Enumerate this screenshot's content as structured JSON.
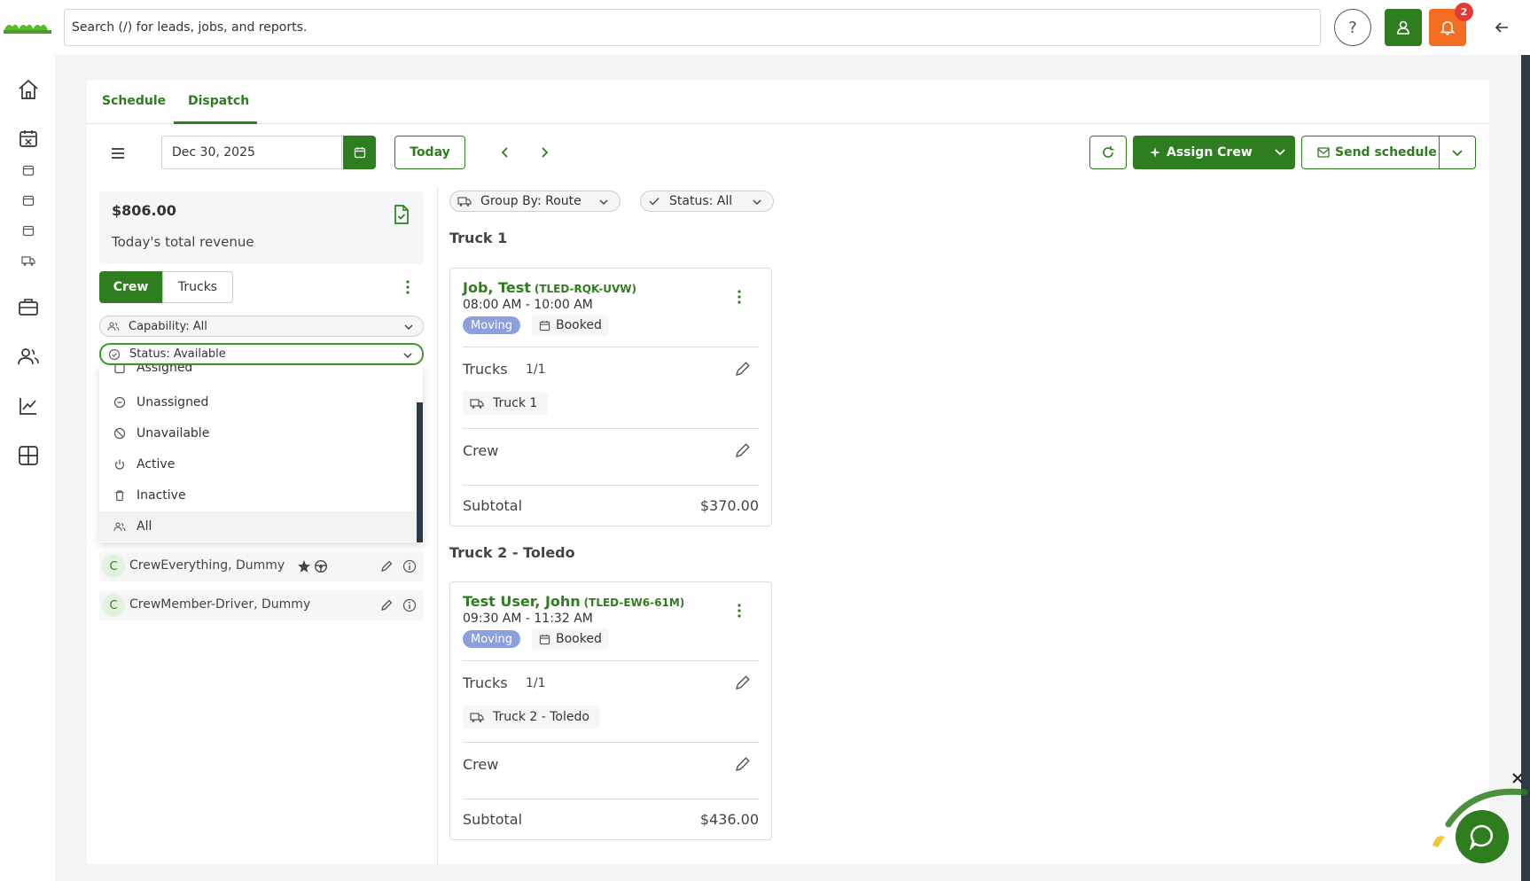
{
  "header": {
    "search_placeholder": "Search (/) for leads, jobs, and reports.",
    "help_label": "?",
    "notification_count": "2"
  },
  "tabs": [
    {
      "label": "Schedule"
    },
    {
      "label": "Dispatch"
    }
  ],
  "toolbar": {
    "date_value": "Dec 30, 2025",
    "today_label": "Today",
    "assign_label": "Assign Crew",
    "send_label": "Send schedule"
  },
  "revenue": {
    "amount": "$806.00",
    "label": "Today's total revenue"
  },
  "segment": {
    "crew_label": "Crew",
    "trucks_label": "Trucks"
  },
  "filters": {
    "capability": "Capability: All",
    "status": "Status: Available"
  },
  "status_options": [
    {
      "label": "Assigned"
    },
    {
      "label": "Unassigned"
    },
    {
      "label": "Unavailable"
    },
    {
      "label": "Active"
    },
    {
      "label": "Inactive"
    },
    {
      "label": "All"
    }
  ],
  "crew_members": [
    {
      "initial": "C",
      "name": "CrewEverything, Dummy"
    },
    {
      "initial": "C",
      "name": "CrewMember-Driver, Dummy"
    }
  ],
  "board": {
    "group_by": "Group By: Route",
    "status": "Status: All",
    "routes": [
      {
        "title": "Truck 1",
        "job": {
          "name": "Job, Test",
          "code": "(TLED-RQK-UVW)",
          "time": "08:00 AM - 10:00 AM",
          "type": "Moving",
          "status": "Booked",
          "trucks_label": "Trucks",
          "trucks_count": "1/1",
          "truck_name": "Truck 1",
          "crew_label": "Crew",
          "subtotal_label": "Subtotal",
          "subtotal": "$370.00"
        }
      },
      {
        "title": "Truck 2 - Toledo",
        "job": {
          "name": "Test User, John",
          "code": "(TLED-EW6-61M)",
          "time": "09:30 AM - 11:32 AM",
          "type": "Moving",
          "status": "Booked",
          "trucks_label": "Trucks",
          "trucks_count": "1/1",
          "truck_name": "Truck 2 - Toledo",
          "crew_label": "Crew",
          "subtotal_label": "Subtotal",
          "subtotal": "$436.00"
        }
      }
    ]
  },
  "colors": {
    "brand_green": "#2e7d1f",
    "notification_orange": "#f36e21",
    "moving_badge": "#8c9fde"
  }
}
